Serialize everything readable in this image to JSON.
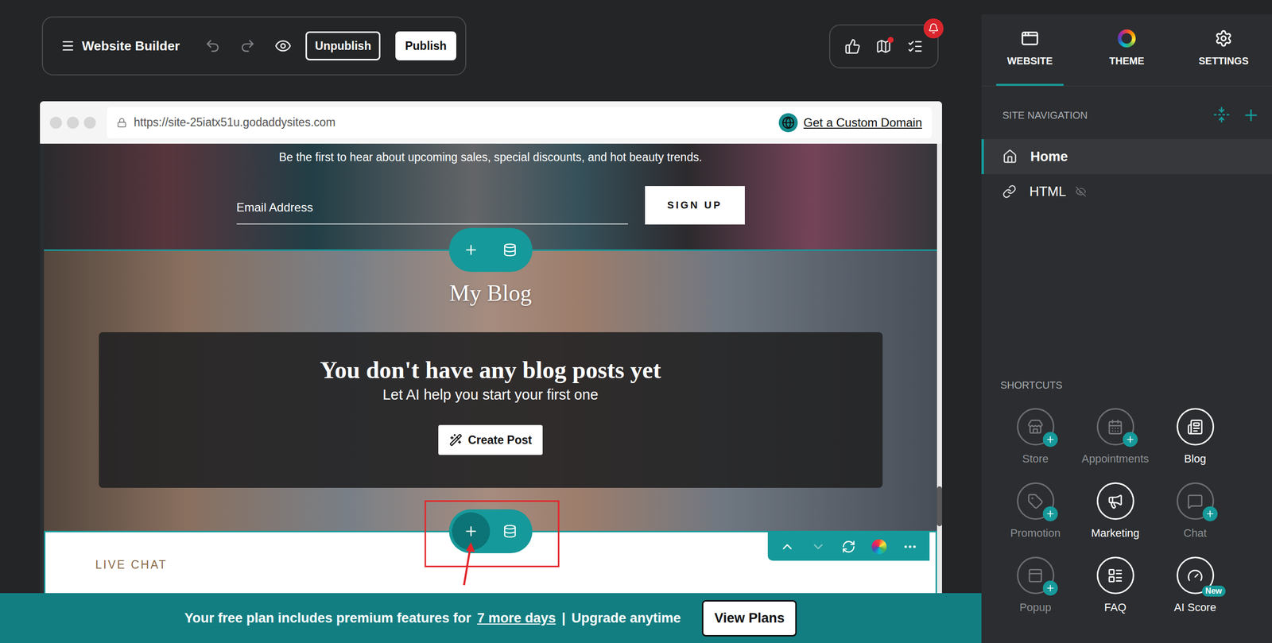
{
  "toolbar": {
    "title": "Website Builder",
    "undo_disabled": true,
    "redo_disabled": true,
    "buttons": [
      {
        "label": "Unpublish",
        "kind": "outline"
      },
      {
        "label": "Publish",
        "kind": "filled"
      }
    ]
  },
  "status_icons": {
    "map_has_dot": true,
    "tasks_has_alert": true
  },
  "browser": {
    "url": "https://site-25iatx51u.godaddysites.com",
    "custom_domain_link": "Get a Custom Domain"
  },
  "sections": {
    "newsletter": {
      "text": "Be the first to hear about upcoming sales, special discounts, and hot beauty trends.",
      "email_placeholder": "Email Address",
      "button": "SIGN UP"
    },
    "blog": {
      "title": "My Blog",
      "empty_title": "You don't have any blog posts yet",
      "empty_subtitle": "Let AI help you start your first one",
      "button": "Create Post"
    },
    "live_chat": {
      "title": "LIVE CHAT",
      "selected": true,
      "toolbar": {
        "move_up_disabled": false,
        "move_down_disabled": true
      }
    }
  },
  "add_section_controls": [
    {
      "highlighted": false
    },
    {
      "highlighted": true
    }
  ],
  "banner": {
    "text_before": "Your free plan includes premium features for",
    "link": "7 more days",
    "separator": "|",
    "text_after": "Upgrade anytime",
    "button": "View Plans"
  },
  "sidebar": {
    "tabs": [
      {
        "label": "WEBSITE",
        "selected": true
      },
      {
        "label": "THEME",
        "selected": false
      },
      {
        "label": "SETTINGS",
        "selected": false
      }
    ],
    "site_navigation": {
      "title": "SITE NAVIGATION",
      "items": [
        {
          "label": "Home",
          "kind": "home",
          "selected": true,
          "hidden": false
        },
        {
          "label": "HTML",
          "kind": "link",
          "selected": false,
          "hidden": true
        }
      ]
    },
    "shortcuts": {
      "title": "SHORTCUTS",
      "items": [
        {
          "label": "Store",
          "added": false
        },
        {
          "label": "Appointments",
          "added": false
        },
        {
          "label": "Blog",
          "added": true
        },
        {
          "label": "Promotion",
          "added": false
        },
        {
          "label": "Marketing",
          "added": true
        },
        {
          "label": "Chat",
          "added": false
        },
        {
          "label": "Popup",
          "added": false
        },
        {
          "label": "FAQ",
          "added": true
        },
        {
          "label": "AI Score",
          "added": true,
          "badge": "New"
        }
      ]
    }
  }
}
